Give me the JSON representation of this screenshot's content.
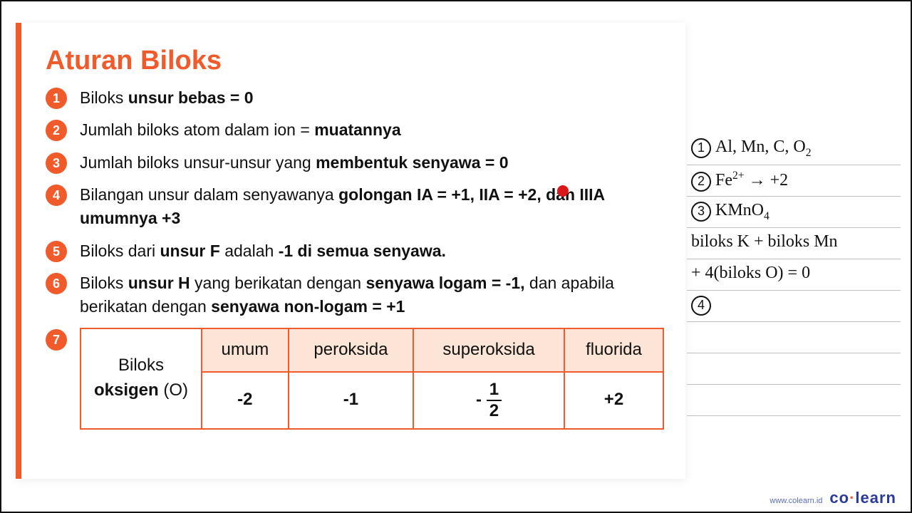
{
  "title": "Aturan Biloks",
  "rules": {
    "r1_a": "Biloks ",
    "r1_b": "unsur bebas = 0",
    "r2_a": "Jumlah biloks atom dalam ion = ",
    "r2_b": "muatannya",
    "r3_a": "Jumlah biloks unsur-unsur yang ",
    "r3_b": "membentuk senyawa = 0",
    "r4_a": "Bilangan unsur dalam senyawanya ",
    "r4_b": "golongan IA = +1, IIA = +2, dan IIIA umumnya +3",
    "r5_a": "Biloks dari ",
    "r5_b": "unsur F",
    "r5_c": " adalah ",
    "r5_d": "-1 di semua senyawa.",
    "r6_a": "Biloks ",
    "r6_b": "unsur H",
    "r6_c": " yang berikatan dengan ",
    "r6_d": "senyawa logam = -1,",
    "r6_e": " dan apabila berikatan dengan ",
    "r6_f": "senyawa non-logam = +1"
  },
  "badges": {
    "1": "1",
    "2": "2",
    "3": "3",
    "4": "4",
    "5": "5",
    "6": "6",
    "7": "7"
  },
  "table": {
    "row_label_a": "Biloks",
    "row_label_b": "oksigen",
    "row_label_c": " (O)",
    "h1": "umum",
    "h2": "peroksida",
    "h3": "superoksida",
    "h4": "fluorida",
    "v1": "-2",
    "v2": "-1",
    "v3_sign": "- ",
    "v3_num": "1",
    "v3_den": "2",
    "v4": "+2"
  },
  "notes": {
    "n1_num": "1",
    "n1_txt": "Al, Mn, C, O",
    "n2_num": "2",
    "n2_a": "Fe",
    "n2_sup": "2+",
    "n2_b": " → +2",
    "n3_num": "3",
    "n3_a": "KMnO",
    "n4": "biloks K + biloks Mn",
    "n5": " + 4(biloks O) = 0",
    "n6_num": "4"
  },
  "footer": {
    "url": "www.colearn.id",
    "brand_a": "co",
    "brand_dot": "·",
    "brand_b": "learn"
  },
  "sub2": "2",
  "sub4": "4"
}
